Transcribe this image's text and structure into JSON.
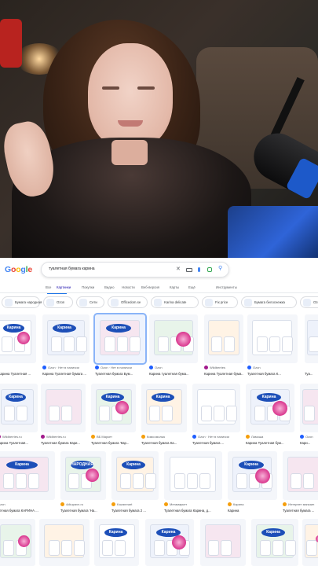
{
  "search": {
    "logo": [
      "G",
      "o",
      "o",
      "g",
      "l",
      "e"
    ],
    "logo_colors": [
      "#4285f4",
      "#ea4335",
      "#fbbc05",
      "#4285f4",
      "#34a853",
      "#ea4335"
    ],
    "query": "туалетная бумага карина",
    "icons": [
      "close-icon",
      "keyboard-icon",
      "mic-icon",
      "lens-icon",
      "search-icon"
    ]
  },
  "tabs": [
    "Все",
    "Картинки",
    "Покупки",
    "Видео",
    "Новости",
    "Веб-версия",
    "Карты",
    "Ещё",
    "Инструменты"
  ],
  "active_tab": 1,
  "chips": [
    {
      "label": "Бумага народная"
    },
    {
      "label": "Ozon"
    },
    {
      "label": "Сети"
    },
    {
      "label": "Officedom.se"
    },
    {
      "label": "Karina delicate"
    },
    {
      "label": "Fix price"
    },
    {
      "label": "Бумага белоснежка"
    },
    {
      "label": "Ozo"
    }
  ],
  "rows": [
    [
      {
        "brand": "Карина",
        "source": "",
        "title": "на Карина Туалетная ..."
      },
      {
        "brand": "Карина",
        "source": "Ozon · Нет в наличии",
        "title": "Карина Туалетная бумага ..."
      },
      {
        "brand": "Карина",
        "source": "Ozon · Нет в наличии",
        "title": "Туалетная бумага Бум...",
        "selected": true
      },
      {
        "brand": "",
        "source": "Ozon",
        "title": "Карина туалетная бума..."
      },
      {
        "brand": "",
        "source": "Wildberries",
        "title": "Карина Туалетная бума..."
      },
      {
        "brand": "",
        "source": "Ozon",
        "title": "Туалетная бумага К..."
      },
      {
        "brand": "",
        "source": "",
        "title": "Туа..."
      }
    ],
    [
      {
        "brand": "Карина",
        "source": "Wildberries.ru",
        "title": "Карина Туалетная..."
      },
      {
        "brand": "",
        "source": "Wildberries.ru",
        "title": "Туалетная бумага Кари..."
      },
      {
        "brand": "Карина",
        "source": "ВБ Маркет",
        "title": "Туалетная бумага 'Кар..."
      },
      {
        "brand": "Карина",
        "source": "Комсомолка",
        "title": "Туалетная бумага Ка..."
      },
      {
        "brand": "",
        "source": "Ozon · Нет в наличии",
        "title": "Туалетная бумага ..."
      },
      {
        "brand": "Карина",
        "source": "Ламоша",
        "title": "Карина Туалетная бум..."
      },
      {
        "brand": "",
        "source": "Ozon",
        "title": "Кари..."
      }
    ],
    [
      {
        "brand": "Карина",
        "source": "Ozon",
        "title": "Туалетная бумага КАРИНА ..."
      },
      {
        "brand": "НАРОДНАЯ",
        "source": "4dkupavn.ru",
        "title": "Туалетная бумага 'На..."
      },
      {
        "brand": "Карина",
        "source": "Kazanmart",
        "title": "Туалетная бумага 2 ..."
      },
      {
        "brand": "",
        "source": "Мегамаркет",
        "title": "Туалетная бумага Карина, д..."
      },
      {
        "brand": "Карина",
        "source": "Карина",
        "title": "Карина"
      },
      {
        "brand": "",
        "source": "Интернет магазин",
        "title": "Туалетная бумага ..."
      }
    ],
    [
      {
        "brand": "",
        "source": "",
        "title": ""
      },
      {
        "brand": "",
        "source": "",
        "title": ""
      },
      {
        "brand": "Карина",
        "source": "",
        "title": ""
      },
      {
        "brand": "Карина",
        "source": "",
        "title": ""
      },
      {
        "brand": "",
        "source": "",
        "title": ""
      },
      {
        "brand": "Карина",
        "source": "",
        "title": ""
      },
      {
        "brand": "",
        "source": "",
        "title": ""
      }
    ]
  ]
}
